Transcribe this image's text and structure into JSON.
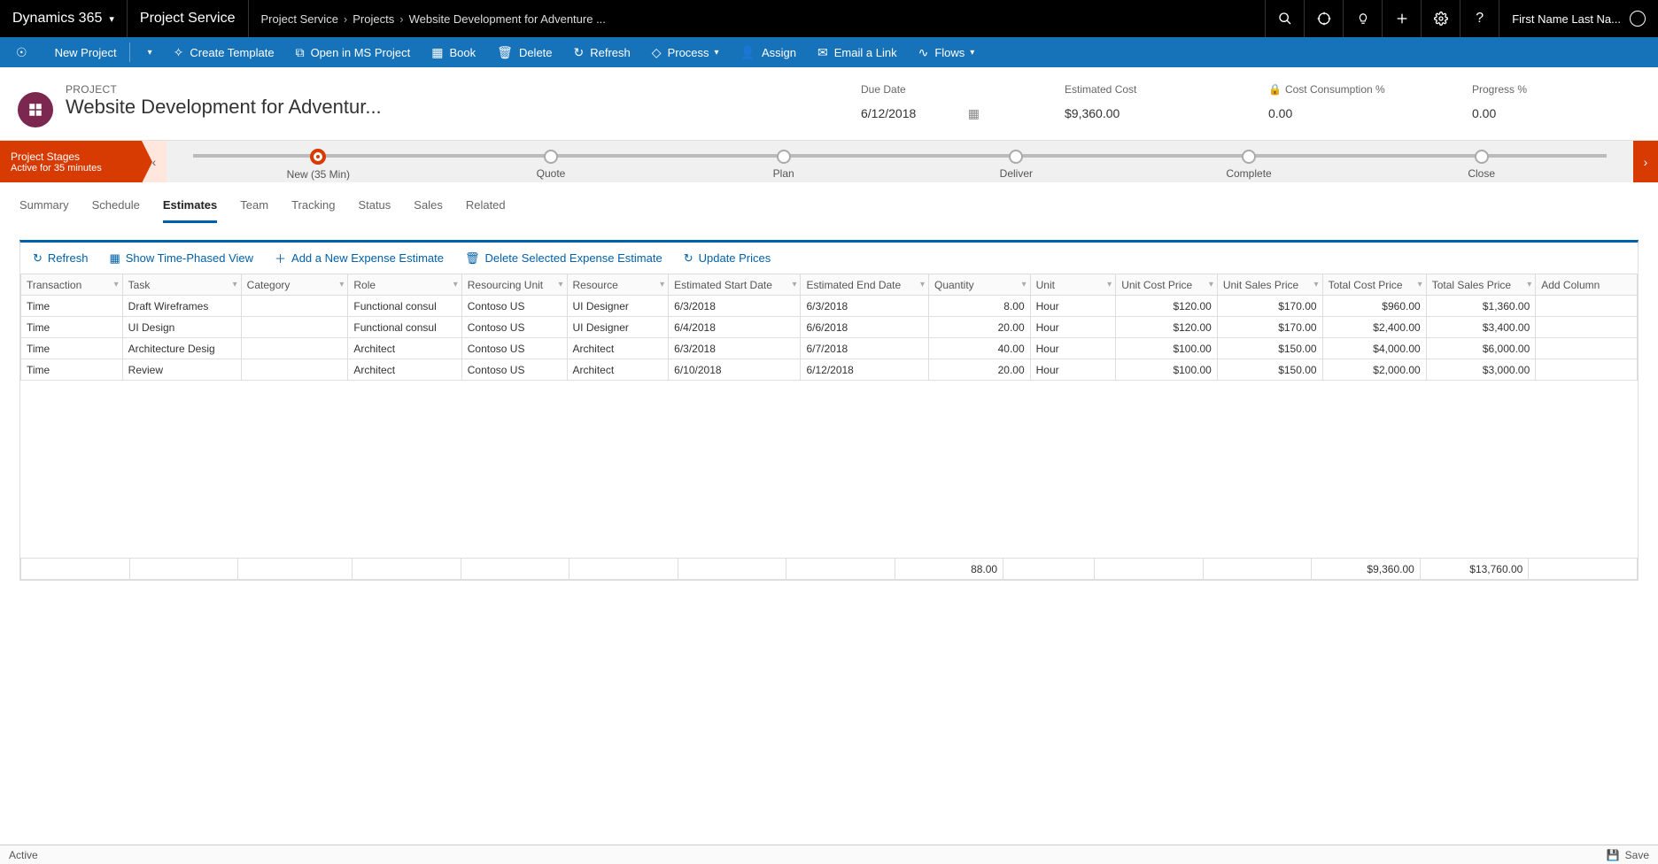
{
  "topbar": {
    "app": "Dynamics 365",
    "module": "Project Service",
    "breadcrumb": [
      "Project Service",
      "Projects",
      "Website Development for Adventure ..."
    ],
    "user": "First Name Last Na..."
  },
  "commands": {
    "new": "New Project",
    "template": "Create Template",
    "open": "Open in MS Project",
    "book": "Book",
    "delete": "Delete",
    "refresh": "Refresh",
    "process": "Process",
    "assign": "Assign",
    "email": "Email a Link",
    "flows": "Flows"
  },
  "record": {
    "type": "PROJECT",
    "name": "Website Development for Adventur...",
    "meta": [
      {
        "label": "Due Date",
        "value": "6/12/2018",
        "calendar": true
      },
      {
        "label": "Estimated Cost",
        "value": "$9,360.00"
      },
      {
        "label": "Cost Consumption %",
        "value": "0.00",
        "lock": true
      },
      {
        "label": "Progress %",
        "value": "0.00"
      }
    ]
  },
  "process": {
    "name": "Project Stages",
    "duration": "Active for 35 minutes",
    "stages": [
      {
        "label": "New  (35 Min)",
        "active": true
      },
      {
        "label": "Quote"
      },
      {
        "label": "Plan"
      },
      {
        "label": "Deliver"
      },
      {
        "label": "Complete"
      },
      {
        "label": "Close"
      }
    ]
  },
  "tabs": [
    "Summary",
    "Schedule",
    "Estimates",
    "Team",
    "Tracking",
    "Status",
    "Sales",
    "Related"
  ],
  "activeTab": "Estimates",
  "gridtoolbar": {
    "refresh": "Refresh",
    "timephased": "Show Time-Phased View",
    "addexpense": "Add a New Expense Estimate",
    "deleteexpense": "Delete Selected Expense Estimate",
    "updateprices": "Update Prices"
  },
  "columns": [
    "Transaction",
    "Task",
    "Category",
    "Role",
    "Resourcing Unit",
    "Resource",
    "Estimated Start Date",
    "Estimated End Date",
    "Quantity",
    "Unit",
    "Unit Cost Price",
    "Unit Sales Price",
    "Total Cost Price",
    "Total Sales Price",
    "Add Column"
  ],
  "rows": [
    {
      "c": [
        "Time",
        "Draft Wireframes",
        "",
        "Functional consul",
        "Contoso US",
        "UI Designer",
        "6/3/2018",
        "6/3/2018",
        "8.00",
        "Hour",
        "$120.00",
        "$170.00",
        "$960.00",
        "$1,360.00"
      ]
    },
    {
      "c": [
        "Time",
        "UI Design",
        "",
        "Functional consul",
        "Contoso US",
        "UI Designer",
        "6/4/2018",
        "6/6/2018",
        "20.00",
        "Hour",
        "$120.00",
        "$170.00",
        "$2,400.00",
        "$3,400.00"
      ]
    },
    {
      "c": [
        "Time",
        "Architecture Desig",
        "",
        "Architect",
        "Contoso US",
        "Architect",
        "6/3/2018",
        "6/7/2018",
        "40.00",
        "Hour",
        "$100.00",
        "$150.00",
        "$4,000.00",
        "$6,000.00"
      ]
    },
    {
      "c": [
        "Time",
        "Review",
        "",
        "Architect",
        "Contoso US",
        "Architect",
        "6/10/2018",
        "6/12/2018",
        "20.00",
        "Hour",
        "$100.00",
        "$150.00",
        "$2,000.00",
        "$3,000.00"
      ]
    }
  ],
  "totals": {
    "quantity": "88.00",
    "totalcost": "$9,360.00",
    "totalsales": "$13,760.00"
  },
  "status": {
    "left": "Active",
    "save": "Save"
  }
}
